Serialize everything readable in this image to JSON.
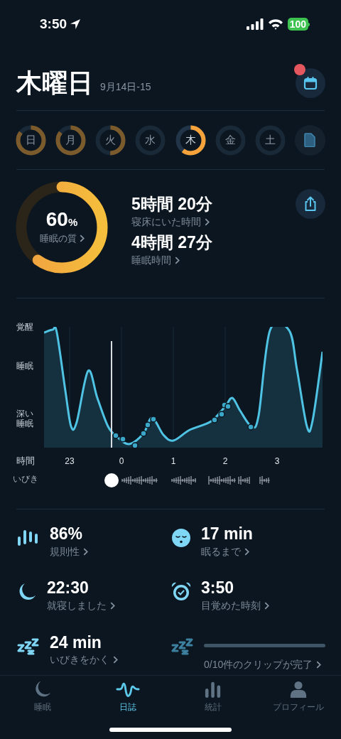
{
  "status_bar": {
    "time": "3:50",
    "battery": "100"
  },
  "header": {
    "title": "木曜日",
    "date_range": "9月14日-15",
    "calendar_badge": true
  },
  "days": [
    {
      "label": "日",
      "selected": false
    },
    {
      "label": "月",
      "selected": false
    },
    {
      "label": "火",
      "selected": false
    },
    {
      "label": "水",
      "selected": false
    },
    {
      "label": "木",
      "selected": true
    },
    {
      "label": "金",
      "selected": false
    },
    {
      "label": "土",
      "selected": false
    }
  ],
  "summary": {
    "quality": {
      "value": "60",
      "unit": "%",
      "label": "睡眠の質"
    },
    "stats": [
      {
        "value": "5時間 20分",
        "label": "寝床にいた時間"
      },
      {
        "value": "4時間 27分",
        "label": "睡眠時間"
      }
    ]
  },
  "chart": {
    "y_labels": [
      "覚醒",
      "睡眠",
      "深い睡眠"
    ],
    "x_label": "時間",
    "x_ticks": [
      "23",
      "0",
      "1",
      "2",
      "3"
    ],
    "snore_label": "いびき"
  },
  "metrics": [
    {
      "kind": "regularity",
      "value": "86%",
      "label": "規則性"
    },
    {
      "kind": "fall_asleep",
      "value": "17 min",
      "label": "眠るまで"
    },
    {
      "kind": "bedtime",
      "value": "22:30",
      "label": "就寝しました"
    },
    {
      "kind": "wake",
      "value": "3:50",
      "label": "目覚めた時刻"
    },
    {
      "kind": "snore",
      "value": "24 min",
      "label": "いびきをかく"
    },
    {
      "kind": "clips",
      "label": "0/10件のクリップが完了"
    }
  ],
  "tabs": [
    {
      "label": "睡眠",
      "selected": false
    },
    {
      "label": "日誌",
      "selected": true
    },
    {
      "label": "統計",
      "selected": false
    },
    {
      "label": "プロフィール",
      "selected": false
    }
  ]
}
